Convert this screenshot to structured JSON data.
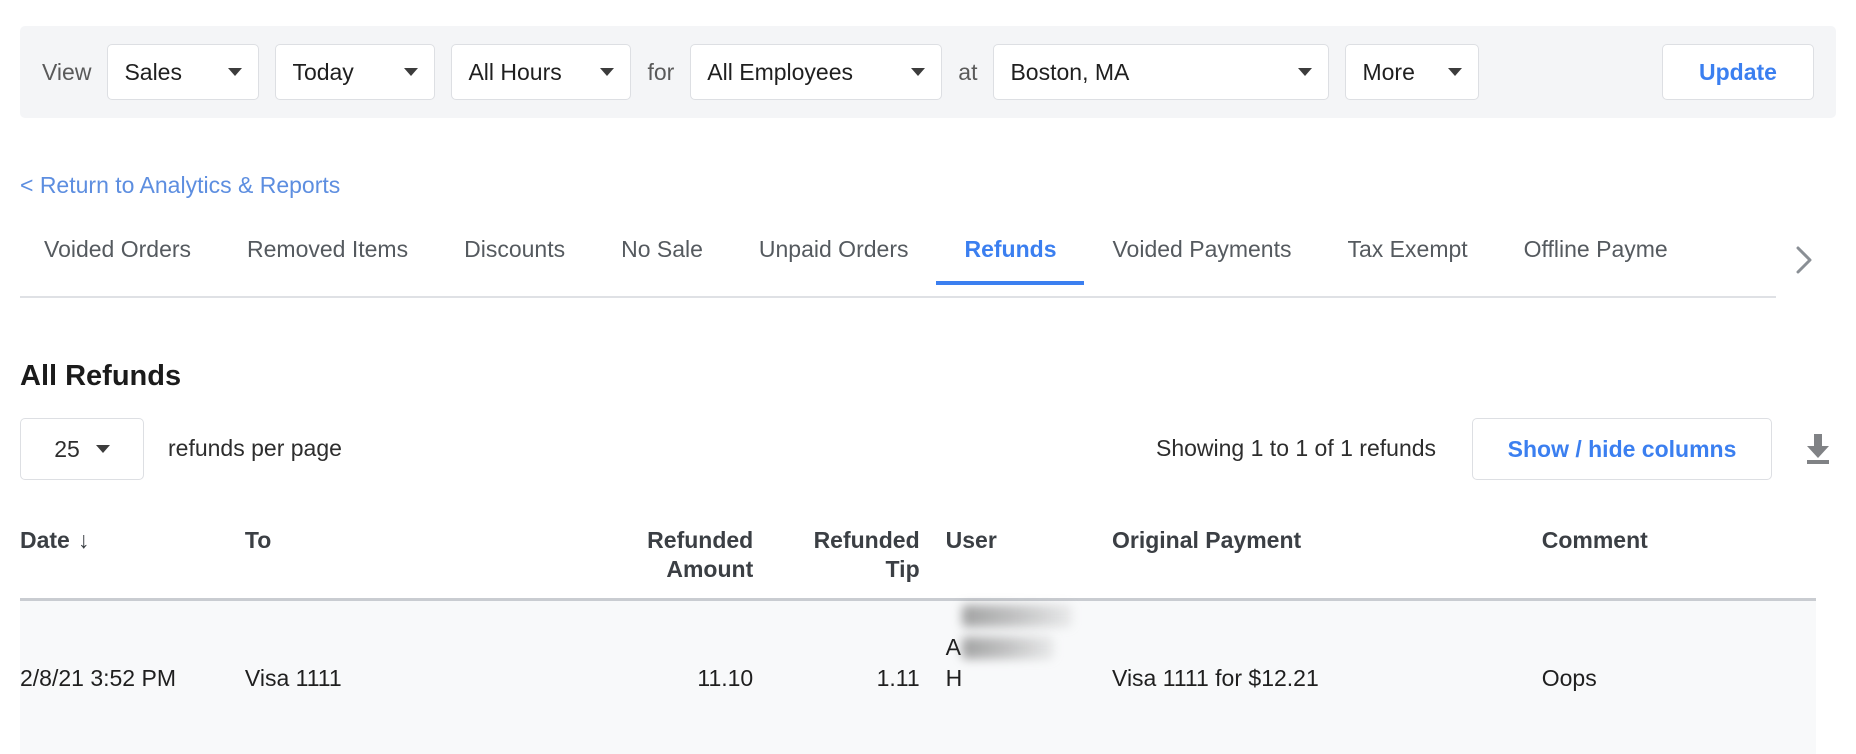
{
  "toolbar": {
    "view_label": "View",
    "for_label": "for",
    "at_label": "at",
    "report_type": "Sales",
    "date_range": "Today",
    "hours": "All Hours",
    "employees": "All Employees",
    "location": "Boston, MA",
    "more": "More",
    "update_label": "Update",
    "accent_color": "#3b7ff0",
    "bar_color": "#f4f5f7"
  },
  "return_link": "< Return to Analytics & Reports",
  "tabs": {
    "items": [
      {
        "label": "Voided Orders",
        "active": false
      },
      {
        "label": "Removed Items",
        "active": false
      },
      {
        "label": "Discounts",
        "active": false
      },
      {
        "label": "No Sale",
        "active": false
      },
      {
        "label": "Unpaid Orders",
        "active": false
      },
      {
        "label": "Refunds",
        "active": true
      },
      {
        "label": "Voided Payments",
        "active": false
      },
      {
        "label": "Tax Exempt",
        "active": false
      },
      {
        "label": "Offline Payme",
        "active": false
      }
    ],
    "next_icon": "chevron-right-icon",
    "active_color": "#3b7ff0"
  },
  "section": {
    "title": "All Refunds"
  },
  "controls": {
    "per_page_value": "25",
    "per_page_label": "refunds per page",
    "showing_text": "Showing 1 to 1 of 1 refunds",
    "show_hide_label": "Show / hide columns",
    "download_icon": "download-icon"
  },
  "table": {
    "columns": [
      {
        "key": "date",
        "label": "Date",
        "sorted": "desc",
        "sort_glyph": "↓"
      },
      {
        "key": "to",
        "label": "To"
      },
      {
        "key": "amount",
        "label": "Refunded\nAmount"
      },
      {
        "key": "tip",
        "label": "Refunded\nTip"
      },
      {
        "key": "user",
        "label": "User"
      },
      {
        "key": "payment",
        "label": "Original Payment"
      },
      {
        "key": "comment",
        "label": "Comment"
      }
    ],
    "rows": [
      {
        "date": "2/8/21 3:52 PM",
        "to": "Visa 1111",
        "amount": "11.10",
        "tip": "1.11",
        "user": "A\nH",
        "user_redacted": true,
        "payment": "Visa 1111 for $12.21",
        "comment": "Oops"
      }
    ]
  }
}
